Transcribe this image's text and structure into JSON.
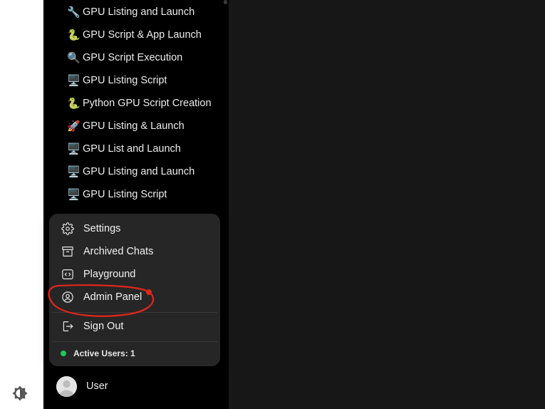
{
  "sidebar": {
    "chats": [
      {
        "emoji": "🔧",
        "label": "GPU Listing and Launch"
      },
      {
        "emoji": "🐍",
        "label": "GPU Script & App Launch"
      },
      {
        "emoji": "🔍",
        "label": "GPU Script Execution"
      },
      {
        "emoji": "🖥️",
        "label": "GPU Listing Script"
      },
      {
        "emoji": "🐍",
        "label": "Python GPU Script Creation"
      },
      {
        "emoji": "🚀",
        "label": "GPU Listing & Launch"
      },
      {
        "emoji": "🖥️",
        "label": "GPU List and Launch"
      },
      {
        "emoji": "🖥️",
        "label": "GPU Listing and Launch"
      },
      {
        "emoji": "🖥️",
        "label": "GPU Listing Script"
      }
    ]
  },
  "user_menu": {
    "items": [
      {
        "icon": "gear-icon",
        "label": "Settings"
      },
      {
        "icon": "archive-icon",
        "label": "Archived Chats"
      },
      {
        "icon": "code-icon",
        "label": "Playground"
      },
      {
        "icon": "user-circle-icon",
        "label": "Admin Panel"
      }
    ],
    "sign_out": {
      "icon": "sign-out-icon",
      "label": "Sign Out"
    },
    "active_users": "Active Users: 1",
    "active_users_color": "#22c55e"
  },
  "user": {
    "name": "User",
    "avatar_icon": "avatar-icon"
  },
  "theme_toggle": {
    "icon": "brightness-icon"
  },
  "annotation": {
    "shape": "red-circle-around-admin-panel",
    "color": "#e3251b"
  }
}
